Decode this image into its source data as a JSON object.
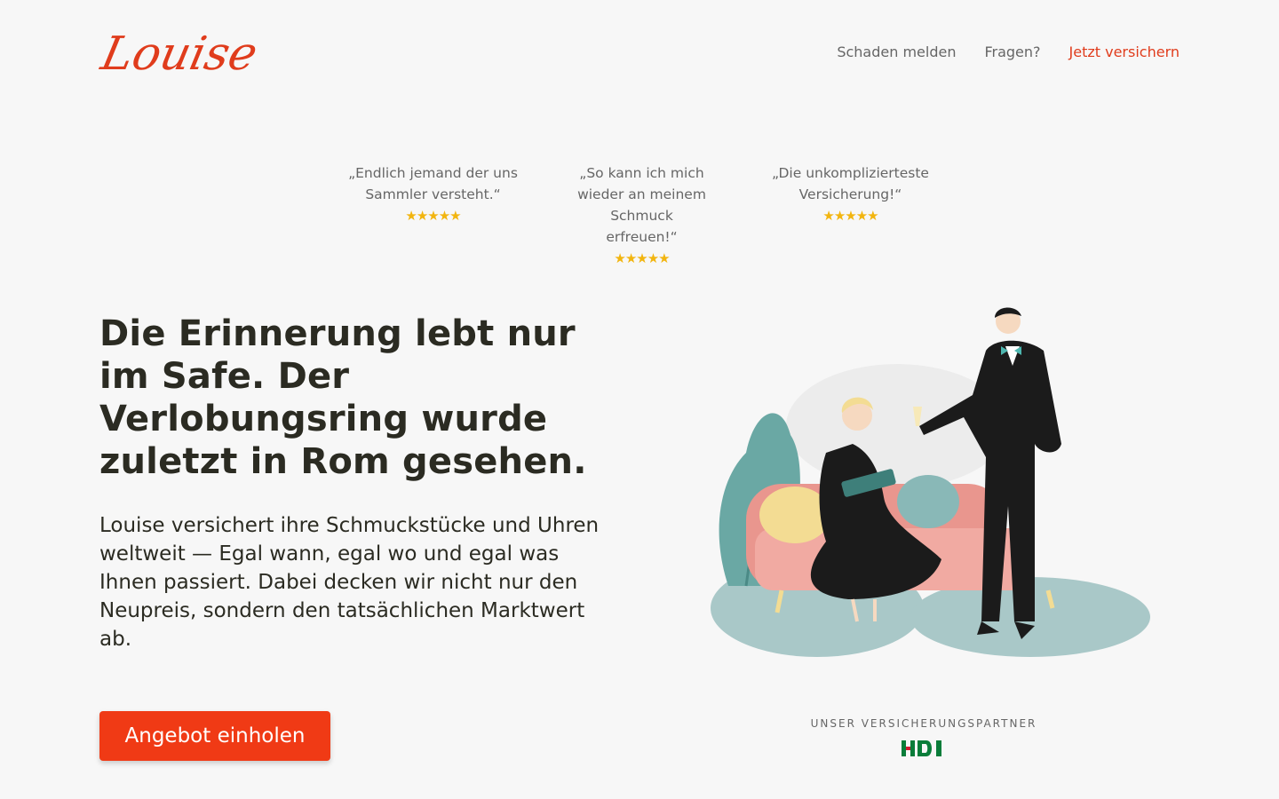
{
  "brand": {
    "logo_text": "Louise",
    "accent": "#e03c1c",
    "button_color": "#f03a15"
  },
  "nav": {
    "items": [
      "Schaden melden",
      "Fragen?"
    ],
    "cta": "Jetzt versichern"
  },
  "reviews": [
    {
      "quote": "„Endlich jemand der uns Sammler versteht.“",
      "stars": 5
    },
    {
      "quote": "„So kann ich mich wieder an meinem Schmuck erfreuen!“",
      "stars": 5
    },
    {
      "quote": "„Die unkomplizierteste Versicherung!“",
      "stars": 5
    }
  ],
  "hero": {
    "headline": "Die Erinnerung lebt nur im Safe. Der Verlobungsring wurde zuletzt in Rom gesehen.",
    "body": "Louise versichert ihre Schmuckstücke und Uhren weltweit — Egal wann, egal wo und egal was Ihnen passiert. Dabei decken wir nicht nur den Neupreis, sondern den tatsächlichen Marktwert ab.",
    "cta": "Angebot einholen"
  },
  "partner": {
    "label": "UNSER VERSICHERUNGSPARTNER",
    "logo_text": "HDI"
  },
  "icons": {
    "stars": "star-icon",
    "illustration": "couple-on-sofa-illustration"
  }
}
